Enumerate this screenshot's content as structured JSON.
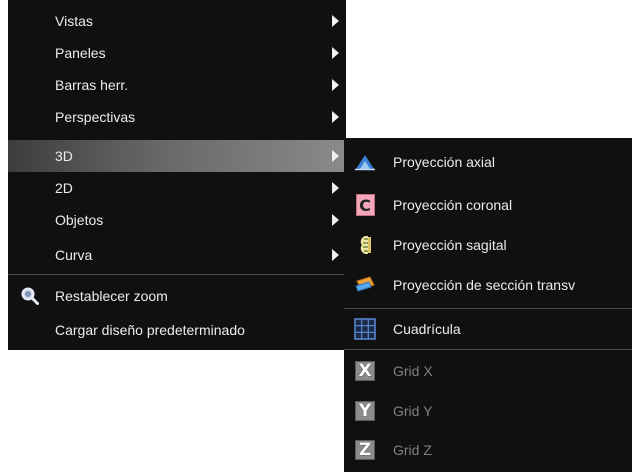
{
  "main_menu": {
    "items": [
      {
        "label": "Vistas"
      },
      {
        "label": "Paneles"
      },
      {
        "label": "Barras herr."
      },
      {
        "label": "Perspectivas"
      },
      {
        "label": "3D"
      },
      {
        "label": "2D"
      },
      {
        "label": "Objetos"
      },
      {
        "label": "Curva"
      }
    ],
    "reset_zoom": {
      "label": "Restablecer zoom",
      "icon": "zoom-icon"
    },
    "load_layout": {
      "label": "Cargar diseño predeterminado"
    }
  },
  "submenu_3d": {
    "items": [
      {
        "label": "Proyección axial",
        "icon": "axial-projection-icon"
      },
      {
        "label": "Proyección coronal",
        "icon": "coronal-projection-icon"
      },
      {
        "label": "Proyección sagital",
        "icon": "sagittal-projection-icon"
      },
      {
        "label": "Proyección de sección transv",
        "icon": "cross-section-projection-icon"
      }
    ],
    "grid": {
      "label": "Cuadrícula",
      "icon": "grid-icon"
    },
    "grid_axes": [
      {
        "label": "Grid X",
        "letter": "X"
      },
      {
        "label": "Grid Y",
        "letter": "Y"
      },
      {
        "label": "Grid Z",
        "letter": "Z"
      }
    ]
  },
  "colors": {
    "menu_background": "#101010",
    "highlight": "#8a8a8a",
    "text": "#ececec",
    "disabled_text": "#808080"
  }
}
